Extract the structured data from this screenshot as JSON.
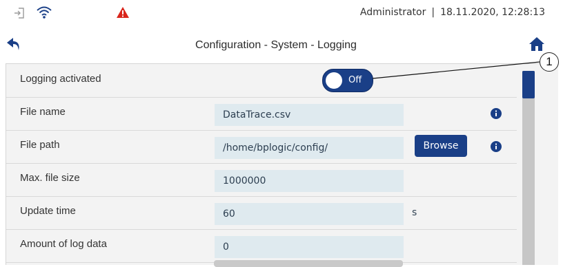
{
  "status": {
    "user": "Administrator",
    "datetime": "18.11.2020, 12:28:13",
    "separator": "|",
    "icons": [
      "login-icon",
      "wifi-icon",
      "warning-icon"
    ],
    "warning_color": "#d9261c"
  },
  "nav": {
    "title": "Configuration - System - Logging",
    "back_icon": "back-arrow-icon",
    "home_icon": "home-icon"
  },
  "rows": {
    "logging": {
      "label": "Logging activated",
      "toggle_state": "Off"
    },
    "file_name": {
      "label": "File name",
      "value": "DataTrace.csv"
    },
    "file_path": {
      "label": "File path",
      "value": "/home/bplogic/config/",
      "browse_label": "Browse"
    },
    "max_size": {
      "label": "Max. file size",
      "value": "1000000"
    },
    "update_time": {
      "label": "Update time",
      "value": "60",
      "unit": "s"
    },
    "amount": {
      "label": "Amount of log data",
      "value": "0"
    }
  },
  "callout": {
    "number": "1"
  },
  "colors": {
    "accent": "#1a3f87",
    "field_bg": "#dfeaef",
    "panel_bg": "#f3f3f3"
  }
}
